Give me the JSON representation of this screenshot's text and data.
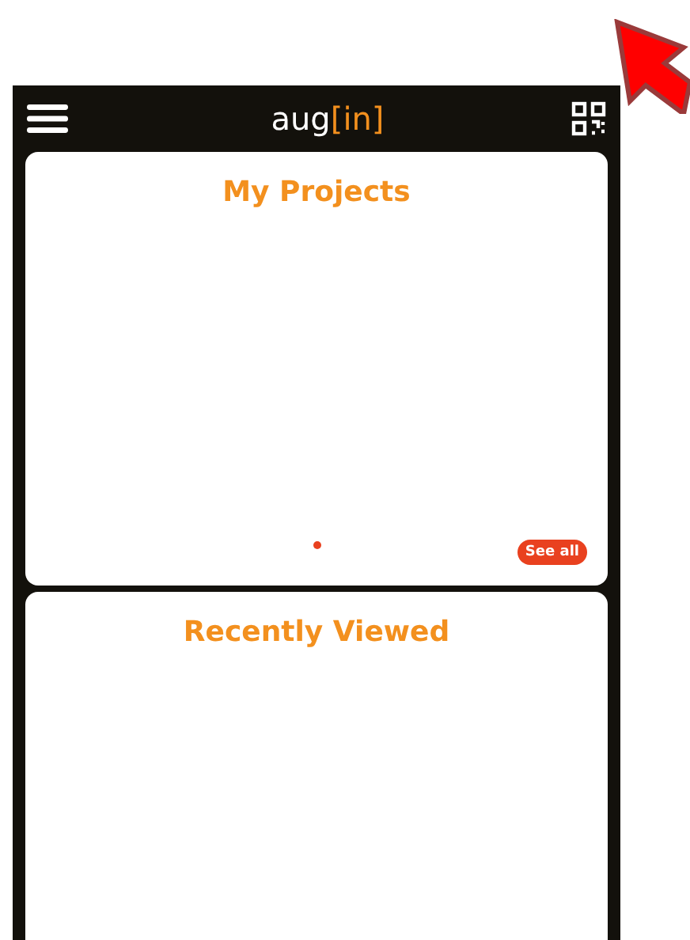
{
  "header": {
    "logo": {
      "text": "aug",
      "accent": "[in]"
    }
  },
  "cards": [
    {
      "title": "My Projects",
      "pager": [
        {
          "selected": true
        }
      ],
      "button": "See all"
    },
    {
      "title": "Recently Viewed"
    }
  ]
}
